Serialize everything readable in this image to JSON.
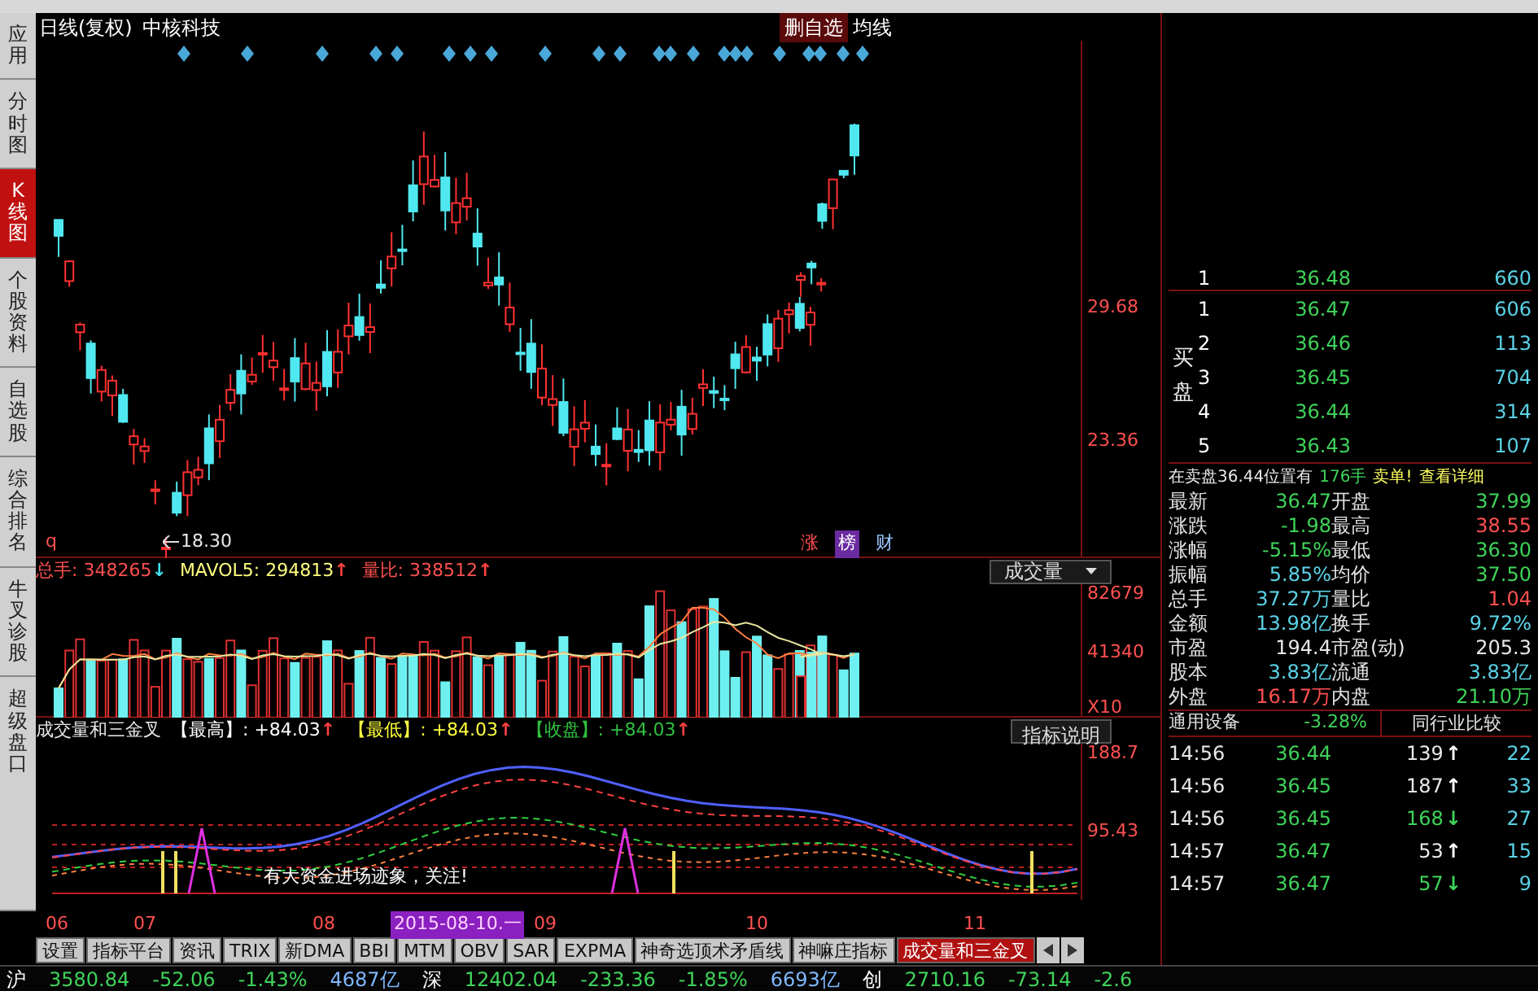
{
  "header": {
    "title": "日线(复权)",
    "stock": "中核科技",
    "actions": [
      {
        "label": "删自选",
        "selected": true
      },
      {
        "label": "均线",
        "selected": false
      }
    ]
  },
  "sidebar": [
    {
      "label": "应用",
      "selected": false
    },
    {
      "label": "分时图",
      "selected": false
    },
    {
      "label": "K线图",
      "selected": true
    },
    {
      "label": "个股资料",
      "selected": false
    },
    {
      "label": "自选股",
      "selected": false
    },
    {
      "label": "综合排名",
      "selected": false
    },
    {
      "label": "牛叉诊股",
      "selected": false
    },
    {
      "label": "超级盘口",
      "selected": false
    }
  ],
  "price_chart": {
    "axis_labels": [
      "29.68",
      "23.36"
    ],
    "low_label": "18.30",
    "marker": "q",
    "tags": [
      {
        "label": "涨",
        "kind": "rise"
      },
      {
        "label": "榜",
        "kind": "rank"
      },
      {
        "label": "财",
        "kind": "finance"
      }
    ]
  },
  "volume": {
    "stats": [
      {
        "label": "总手:",
        "value": "348265",
        "arrow": "↓",
        "rising": false
      },
      {
        "label": "MAVOL5:",
        "value": "294813",
        "arrow": "↑",
        "rising": true
      },
      {
        "label": "量比:",
        "value": "338512",
        "arrow": "↑",
        "rising": true
      }
    ],
    "dropdown": "成交量",
    "axis_labels": [
      "82679",
      "41340",
      "X10"
    ]
  },
  "indicator": {
    "name": "成交量和三金叉",
    "stats": [
      {
        "label": "【最高】",
        "value": ": +84.03",
        "color": "#ffffff",
        "arrow": "↑"
      },
      {
        "label": "【最低】",
        "value": ": +84.03",
        "color": "#ffff40",
        "arrow": "↑"
      },
      {
        "label": "【收盘】",
        "value": ": +84.03",
        "color": "#30c040",
        "arrow": "↑"
      }
    ],
    "button": "指标说明",
    "axis_labels": [
      "188.7",
      "95.43"
    ],
    "annotation": "有大资金进场迹象，关注!"
  },
  "dates": [
    {
      "label": "06",
      "selected": false
    },
    {
      "label": "07",
      "selected": false
    },
    {
      "label": "08",
      "selected": false
    },
    {
      "label": "2015-08-10.一",
      "selected": true
    },
    {
      "label": "09",
      "selected": false
    },
    {
      "label": "10",
      "selected": false
    },
    {
      "label": "11",
      "selected": false
    }
  ],
  "tabs": [
    {
      "label": "设置",
      "selected": false
    },
    {
      "label": "指标平台",
      "selected": false
    },
    {
      "label": "资讯",
      "selected": false
    },
    {
      "label": "TRIX",
      "selected": false
    },
    {
      "label": "新DMA",
      "selected": false
    },
    {
      "label": "BBI",
      "selected": false
    },
    {
      "label": "MTM",
      "selected": false
    },
    {
      "label": "OBV",
      "selected": false
    },
    {
      "label": "SAR",
      "selected": false
    },
    {
      "label": "EXPMA",
      "selected": false
    },
    {
      "label": "神奇选顶术矛盾线",
      "selected": false
    },
    {
      "label": "神嘛庄指标",
      "selected": false
    },
    {
      "label": "成交量和三金叉",
      "selected": true
    }
  ],
  "order_book": {
    "side_label": "买盘",
    "sell": [
      {
        "rank": "1",
        "price": "36.48",
        "volume": "660"
      }
    ],
    "buy": [
      {
        "rank": "1",
        "price": "36.47",
        "volume": "606"
      },
      {
        "rank": "2",
        "price": "36.46",
        "volume": "113"
      },
      {
        "rank": "3",
        "price": "36.45",
        "volume": "704"
      },
      {
        "rank": "4",
        "price": "36.44",
        "volume": "314"
      },
      {
        "rank": "5",
        "price": "36.43",
        "volume": "107"
      }
    ]
  },
  "notice": [
    "在卖盘36.44位置有",
    "176手",
    "卖单!",
    "查看详细"
  ],
  "quote": [
    {
      "label": "最新",
      "value": "36.47",
      "color": "#3fd35a"
    },
    {
      "label": "开盘",
      "value": "37.99",
      "color": "#3fd35a"
    },
    {
      "label": "涨跌",
      "value": "-1.98",
      "color": "#3fd35a"
    },
    {
      "label": "最高",
      "value": "38.55",
      "color": "#ff5050"
    },
    {
      "label": "涨幅",
      "value": "-5.15%",
      "color": "#3fd35a"
    },
    {
      "label": "最低",
      "value": "36.30",
      "color": "#3fd35a"
    },
    {
      "label": "振幅",
      "value": "5.85%",
      "color": "#5ad2e6"
    },
    {
      "label": "均价",
      "value": "37.50",
      "color": "#3fd35a"
    },
    {
      "label": "总手",
      "value": "37.27万",
      "color": "#5ad2e6"
    },
    {
      "label": "量比",
      "value": "1.04",
      "color": "#ff5050"
    },
    {
      "label": "金额",
      "value": "13.98亿",
      "color": "#5ad2e6"
    },
    {
      "label": "换手",
      "value": "9.72%",
      "color": "#5ad2e6"
    },
    {
      "label": "市盈",
      "value": "194.4",
      "color": "#e8e8e8"
    },
    {
      "label": "市盈(动)",
      "value": "205.3",
      "color": "#e8e8e8"
    },
    {
      "label": "股本",
      "value": "3.83亿",
      "color": "#5ad2e6"
    },
    {
      "label": "流通",
      "value": "3.83亿",
      "color": "#5ad2e6"
    },
    {
      "label": "外盘",
      "value": "16.17万",
      "color": "#ff5050"
    },
    {
      "label": "内盘",
      "value": "21.10万",
      "color": "#3fd35a"
    }
  ],
  "industry": {
    "name": "通用设备",
    "change": "-3.28%",
    "button": "同行业比较"
  },
  "ticks": [
    {
      "time": "14:56",
      "price": "36.44",
      "volume": "139",
      "arrow": "↑",
      "rising": true,
      "count": "22"
    },
    {
      "time": "14:56",
      "price": "36.45",
      "volume": "187",
      "arrow": "↑",
      "rising": true,
      "count": "33"
    },
    {
      "time": "14:56",
      "price": "36.45",
      "volume": "168",
      "arrow": "↓",
      "rising": false,
      "count": "27"
    },
    {
      "time": "14:57",
      "price": "36.47",
      "volume": "53",
      "arrow": "↑",
      "rising": true,
      "count": "15"
    },
    {
      "time": "14:57",
      "price": "36.47",
      "volume": "57",
      "arrow": "↓",
      "rising": false,
      "count": "9"
    }
  ],
  "status_bar": [
    {
      "text": "沪",
      "color": "#ffffff"
    },
    {
      "text": "3580.84",
      "color": "#3fd35a"
    },
    {
      "text": "-52.06",
      "color": "#3fd35a"
    },
    {
      "text": "-1.43%",
      "color": "#3fd35a"
    },
    {
      "text": "4687亿",
      "color": "#7fb8ff"
    },
    {
      "text": "深",
      "color": "#ffffff"
    },
    {
      "text": "12402.04",
      "color": "#3fd35a"
    },
    {
      "text": "-233.36",
      "color": "#3fd35a"
    },
    {
      "text": "-1.85%",
      "color": "#3fd35a"
    },
    {
      "text": "6693亿",
      "color": "#7fb8ff"
    },
    {
      "text": "创",
      "color": "#ffffff"
    },
    {
      "text": "2710.16",
      "color": "#3fd35a"
    },
    {
      "text": "-73.14",
      "color": "#3fd35a"
    },
    {
      "text": "-2.6",
      "color": "#3fd35a"
    }
  ]
}
